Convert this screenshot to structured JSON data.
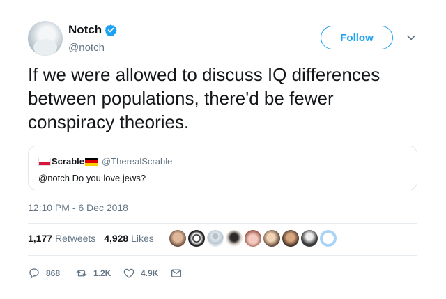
{
  "author": {
    "display_name": "Notch",
    "handle": "@notch",
    "verified_icon": "verified-badge-icon"
  },
  "follow_button": {
    "label": "Follow"
  },
  "tweet": {
    "text": "If we were allowed to discuss IQ differences between populations, there'd be fewer conspiracy theories.",
    "timestamp": "12:10 PM - 6 Dec 2018"
  },
  "quoted_tweet": {
    "display_name": "Scrable",
    "handle": "@TherealScrable",
    "text": "@notch Do you love jews?"
  },
  "stats": {
    "retweets_count": "1,177",
    "retweets_label": "Retweets",
    "likes_count": "4,928",
    "likes_label": "Likes"
  },
  "actions": {
    "replies": "868",
    "retweets": "1.2K",
    "likes": "4.9K"
  },
  "colors": {
    "accent": "#1da1f2",
    "text": "#14171a",
    "muted": "#657786",
    "border": "#e1e8ed"
  }
}
